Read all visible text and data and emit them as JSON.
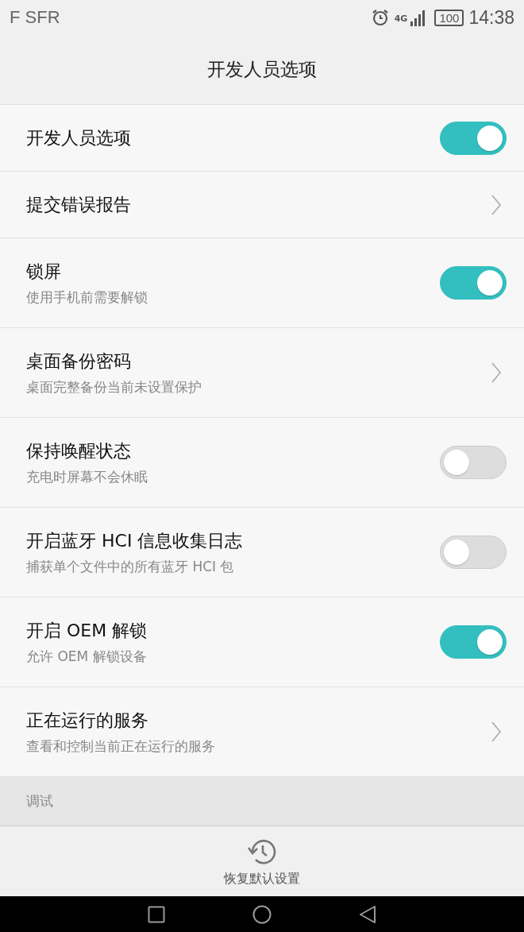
{
  "status_bar": {
    "carrier": "F SFR",
    "network": "4G",
    "battery": "100",
    "time": "14:38"
  },
  "title": "开发人员选项",
  "items": [
    {
      "kind": "toggle",
      "title": "开发人员选项",
      "on": true
    },
    {
      "kind": "link",
      "title": "提交错误报告"
    },
    {
      "kind": "toggle",
      "title": "锁屏",
      "subtitle": "使用手机前需要解锁",
      "on": true
    },
    {
      "kind": "link",
      "title": "桌面备份密码",
      "subtitle": "桌面完整备份当前未设置保护"
    },
    {
      "kind": "toggle",
      "title": "保持唤醒状态",
      "subtitle": "充电时屏幕不会休眠",
      "on": false
    },
    {
      "kind": "toggle",
      "title": "开启蓝牙 HCI 信息收集日志",
      "subtitle": "捕获单个文件中的所有蓝牙 HCI 包",
      "on": false
    },
    {
      "kind": "toggle",
      "title": "开启 OEM 解锁",
      "subtitle": "允许 OEM 解锁设备",
      "on": true
    },
    {
      "kind": "link",
      "title": "正在运行的服务",
      "subtitle": "查看和控制当前正在运行的服务"
    }
  ],
  "section_header": "调试",
  "reset_button": "恢复默认设置"
}
